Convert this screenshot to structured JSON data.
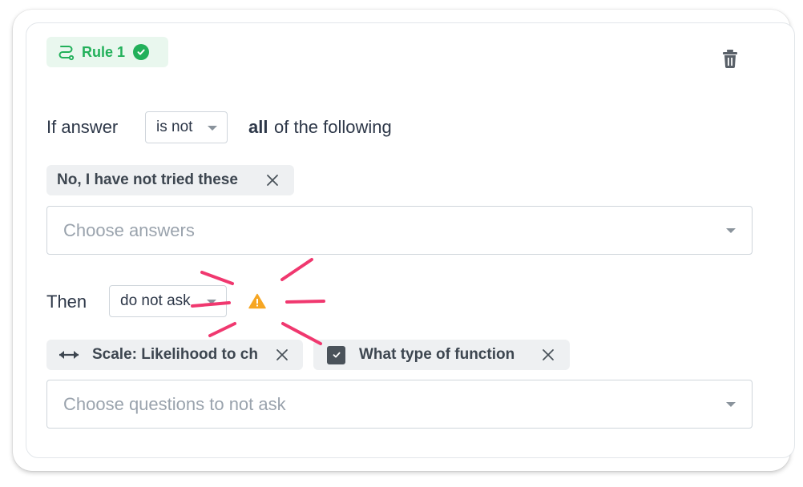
{
  "rule": {
    "label": "Rule 1"
  },
  "condition": {
    "prefix": "If answer",
    "operator": "is not",
    "quantifier": "all",
    "suffix": "of the following"
  },
  "answers": {
    "chips": [
      {
        "label": "No, I have not tried these"
      }
    ],
    "placeholder": "Choose answers"
  },
  "action": {
    "prefix": "Then",
    "value": "do not ask"
  },
  "questions": {
    "chips": [
      {
        "label": "Scale: Likelihood to ch",
        "icon": "scale-arrows-icon"
      },
      {
        "label": "What type of function",
        "icon": "checkbox-icon"
      }
    ],
    "placeholder": "Choose questions to not ask"
  },
  "colors": {
    "accent_green": "#22b05a",
    "warning_orange": "#f6a623",
    "annotation_pink": "#f0386f"
  }
}
